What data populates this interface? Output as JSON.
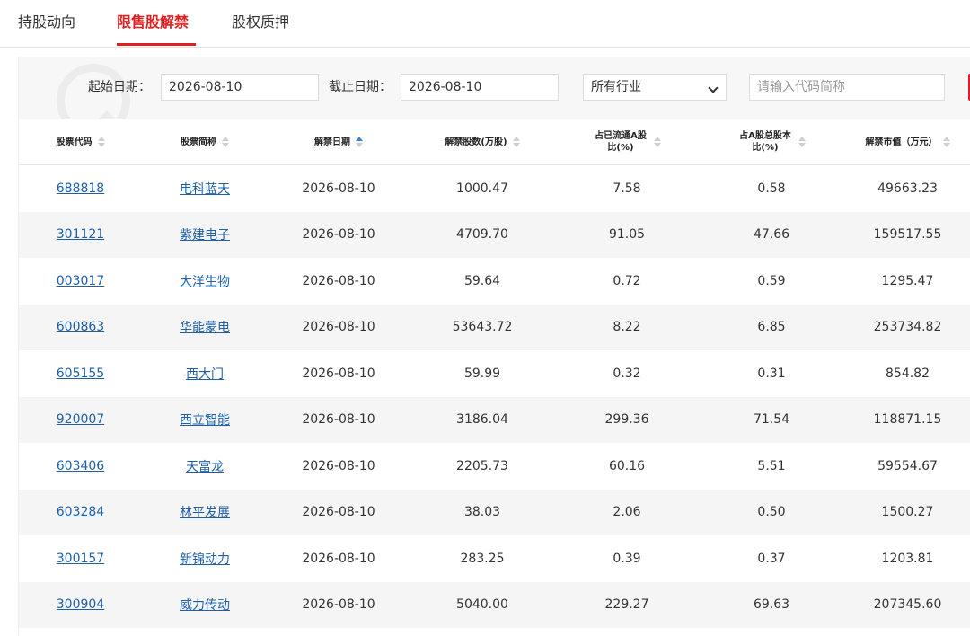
{
  "tabs": [
    {
      "label": "持股动向"
    },
    {
      "label": "限售股解禁",
      "active": true
    },
    {
      "label": "股权质押"
    }
  ],
  "filters": {
    "start_label": "起始日期：",
    "start_value": "2026-08-10",
    "end_label": "截止日期：",
    "end_value": "2026-08-10",
    "industry_value": "所有行业",
    "search_placeholder": "请输入代码简称"
  },
  "table": {
    "headers": [
      {
        "label": "股票代码"
      },
      {
        "label": "股票简称"
      },
      {
        "label": "解禁日期",
        "sorted": "asc"
      },
      {
        "label": "解禁股数(万股)"
      },
      {
        "label": "占已流通A股比(%)"
      },
      {
        "label": "占A股总股本比(%)"
      },
      {
        "label": "解禁市值（万元）"
      }
    ],
    "rows": [
      [
        "688818",
        "电科蓝天",
        "2026-08-10",
        "1000.47",
        "7.58",
        "0.58",
        "49663.23"
      ],
      [
        "301121",
        "紫建电子",
        "2026-08-10",
        "4709.70",
        "91.05",
        "47.66",
        "159517.55"
      ],
      [
        "003017",
        "大洋生物",
        "2026-08-10",
        "59.64",
        "0.72",
        "0.59",
        "1295.47"
      ],
      [
        "600863",
        "华能蒙电",
        "2026-08-10",
        "53643.72",
        "8.22",
        "6.85",
        "253734.82"
      ],
      [
        "605155",
        "西大门",
        "2026-08-10",
        "59.99",
        "0.32",
        "0.31",
        "854.82"
      ],
      [
        "920007",
        "西立智能",
        "2026-08-10",
        "3186.04",
        "299.36",
        "71.54",
        "118871.15"
      ],
      [
        "603406",
        "天富龙",
        "2026-08-10",
        "2205.73",
        "60.16",
        "5.51",
        "59554.67"
      ],
      [
        "603284",
        "林平发展",
        "2026-08-10",
        "38.03",
        "2.06",
        "0.50",
        "1500.27"
      ],
      [
        "300157",
        "新锦动力",
        "2026-08-10",
        "283.25",
        "0.39",
        "0.37",
        "1203.81"
      ],
      [
        "300904",
        "威力传动",
        "2026-08-10",
        "5040.00",
        "229.27",
        "69.63",
        "207345.60"
      ]
    ]
  },
  "colors": {
    "accent": "#e02020",
    "link": "#1f5fa8",
    "sort_active": "#3b82d6"
  }
}
